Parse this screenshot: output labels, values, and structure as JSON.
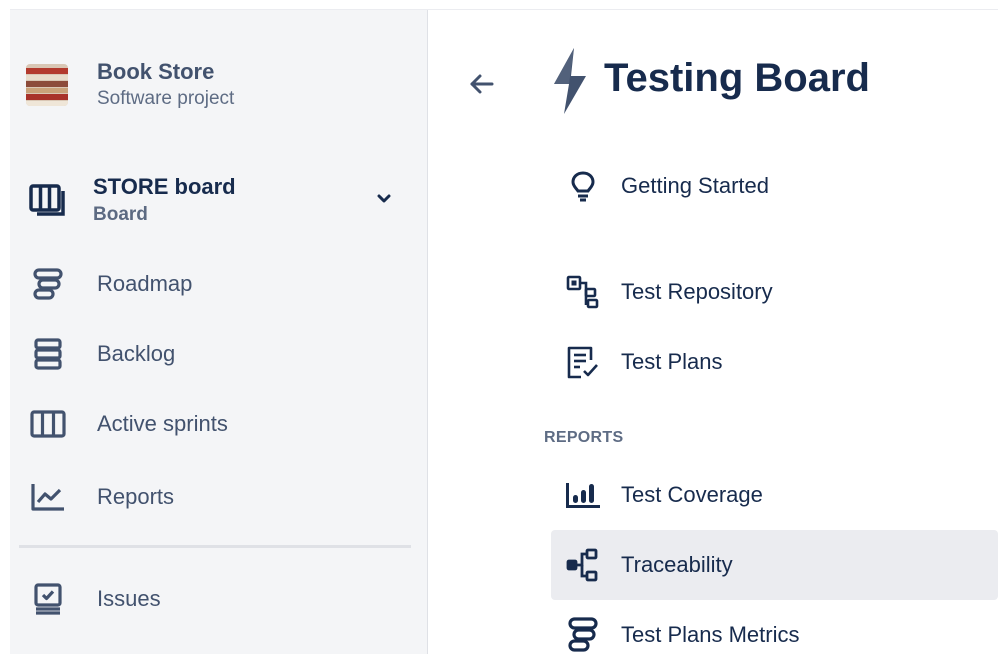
{
  "project": {
    "name": "Book Store",
    "type": "Software project"
  },
  "board": {
    "name": "STORE board",
    "subtitle": "Board"
  },
  "sidebar": {
    "items": [
      {
        "label": "Roadmap",
        "icon": "roadmap-icon"
      },
      {
        "label": "Backlog",
        "icon": "backlog-icon"
      },
      {
        "label": "Active sprints",
        "icon": "active-sprints-icon"
      },
      {
        "label": "Reports",
        "icon": "reports-icon"
      },
      {
        "label": "Issues",
        "icon": "issues-icon"
      }
    ]
  },
  "panel": {
    "title": "Testing Board",
    "section_reports": "REPORTS",
    "items": [
      {
        "label": "Getting Started",
        "icon": "lightbulb-icon"
      },
      {
        "label": "Test Repository",
        "icon": "test-repository-icon"
      },
      {
        "label": "Test Plans",
        "icon": "test-plans-icon"
      },
      {
        "label": "Test Coverage",
        "icon": "test-coverage-icon"
      },
      {
        "label": "Traceability",
        "icon": "traceability-icon",
        "active": true
      },
      {
        "label": "Test Plans Metrics",
        "icon": "test-plans-metrics-icon"
      }
    ]
  },
  "colors": {
    "sidebar_bg": "#f4f5f7",
    "text_primary": "#172b4d",
    "text_secondary": "#42526e",
    "active_bg": "#ebecf0",
    "bolt": "#42526e"
  }
}
